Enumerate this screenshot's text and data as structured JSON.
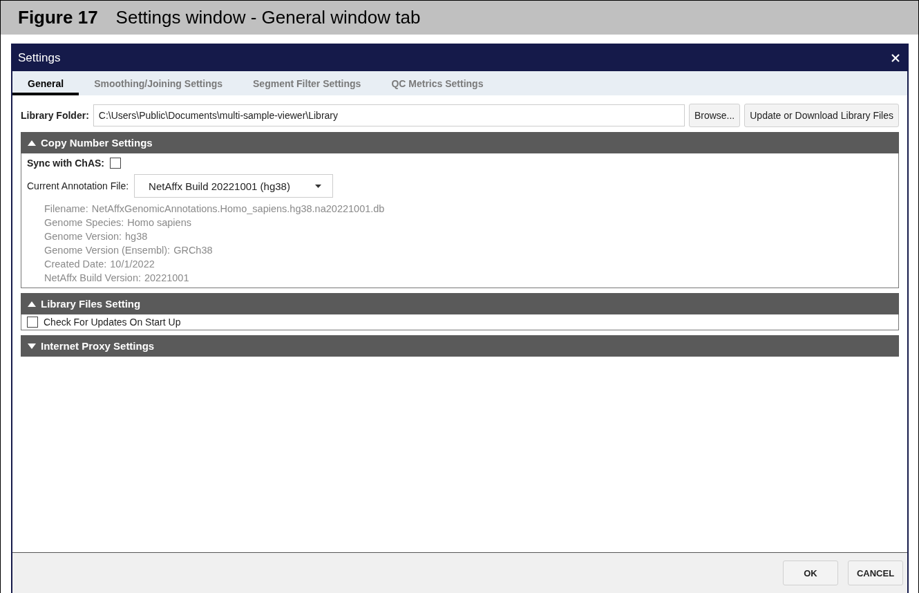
{
  "figure": {
    "label": "Figure 17",
    "caption": "Settings window - General window tab"
  },
  "window": {
    "title": "Settings"
  },
  "tabs": [
    {
      "label": "General",
      "selected": true
    },
    {
      "label": "Smoothing/Joining Settings",
      "selected": false
    },
    {
      "label": "Segment Filter Settings",
      "selected": false
    },
    {
      "label": "QC Metrics Settings",
      "selected": false
    }
  ],
  "library_folder": {
    "label": "Library Folder:",
    "value": "C:\\Users\\Public\\Documents\\multi-sample-viewer\\Library",
    "buttons": [
      "Browse...",
      "Update or Download Library Files"
    ]
  },
  "sections": [
    {
      "kind": "copy_number",
      "title": "Copy Number Settings",
      "expanded": true,
      "sync": {
        "label": "Sync with ChAS:",
        "checked": false
      },
      "annotation": {
        "label": "Current Annotation File:",
        "value": "NetAffx Build 20221001 (hg38)"
      },
      "details": [
        {
          "label": "Filename:",
          "value": "NetAffxGenomicAnnotations.Homo_sapiens.hg38.na20221001.db"
        },
        {
          "label": "Genome Species:",
          "value": "Homo sapiens"
        },
        {
          "label": "Genome Version:",
          "value": "hg38"
        },
        {
          "label": "Genome Version (Ensembl):",
          "value": "GRCh38"
        },
        {
          "label": "Created Date:",
          "value": "10/1/2022"
        },
        {
          "label": "NetAffx Build Version:",
          "value": "20221001"
        }
      ]
    },
    {
      "kind": "library_files",
      "title": "Library Files Setting",
      "expanded": true,
      "checkbox": {
        "label": "Check For Updates On Start Up",
        "checked": false
      }
    },
    {
      "kind": "proxy",
      "title": "Internet Proxy Settings",
      "expanded": false
    }
  ],
  "footer": {
    "buttons": [
      "OK",
      "CANCEL"
    ]
  }
}
